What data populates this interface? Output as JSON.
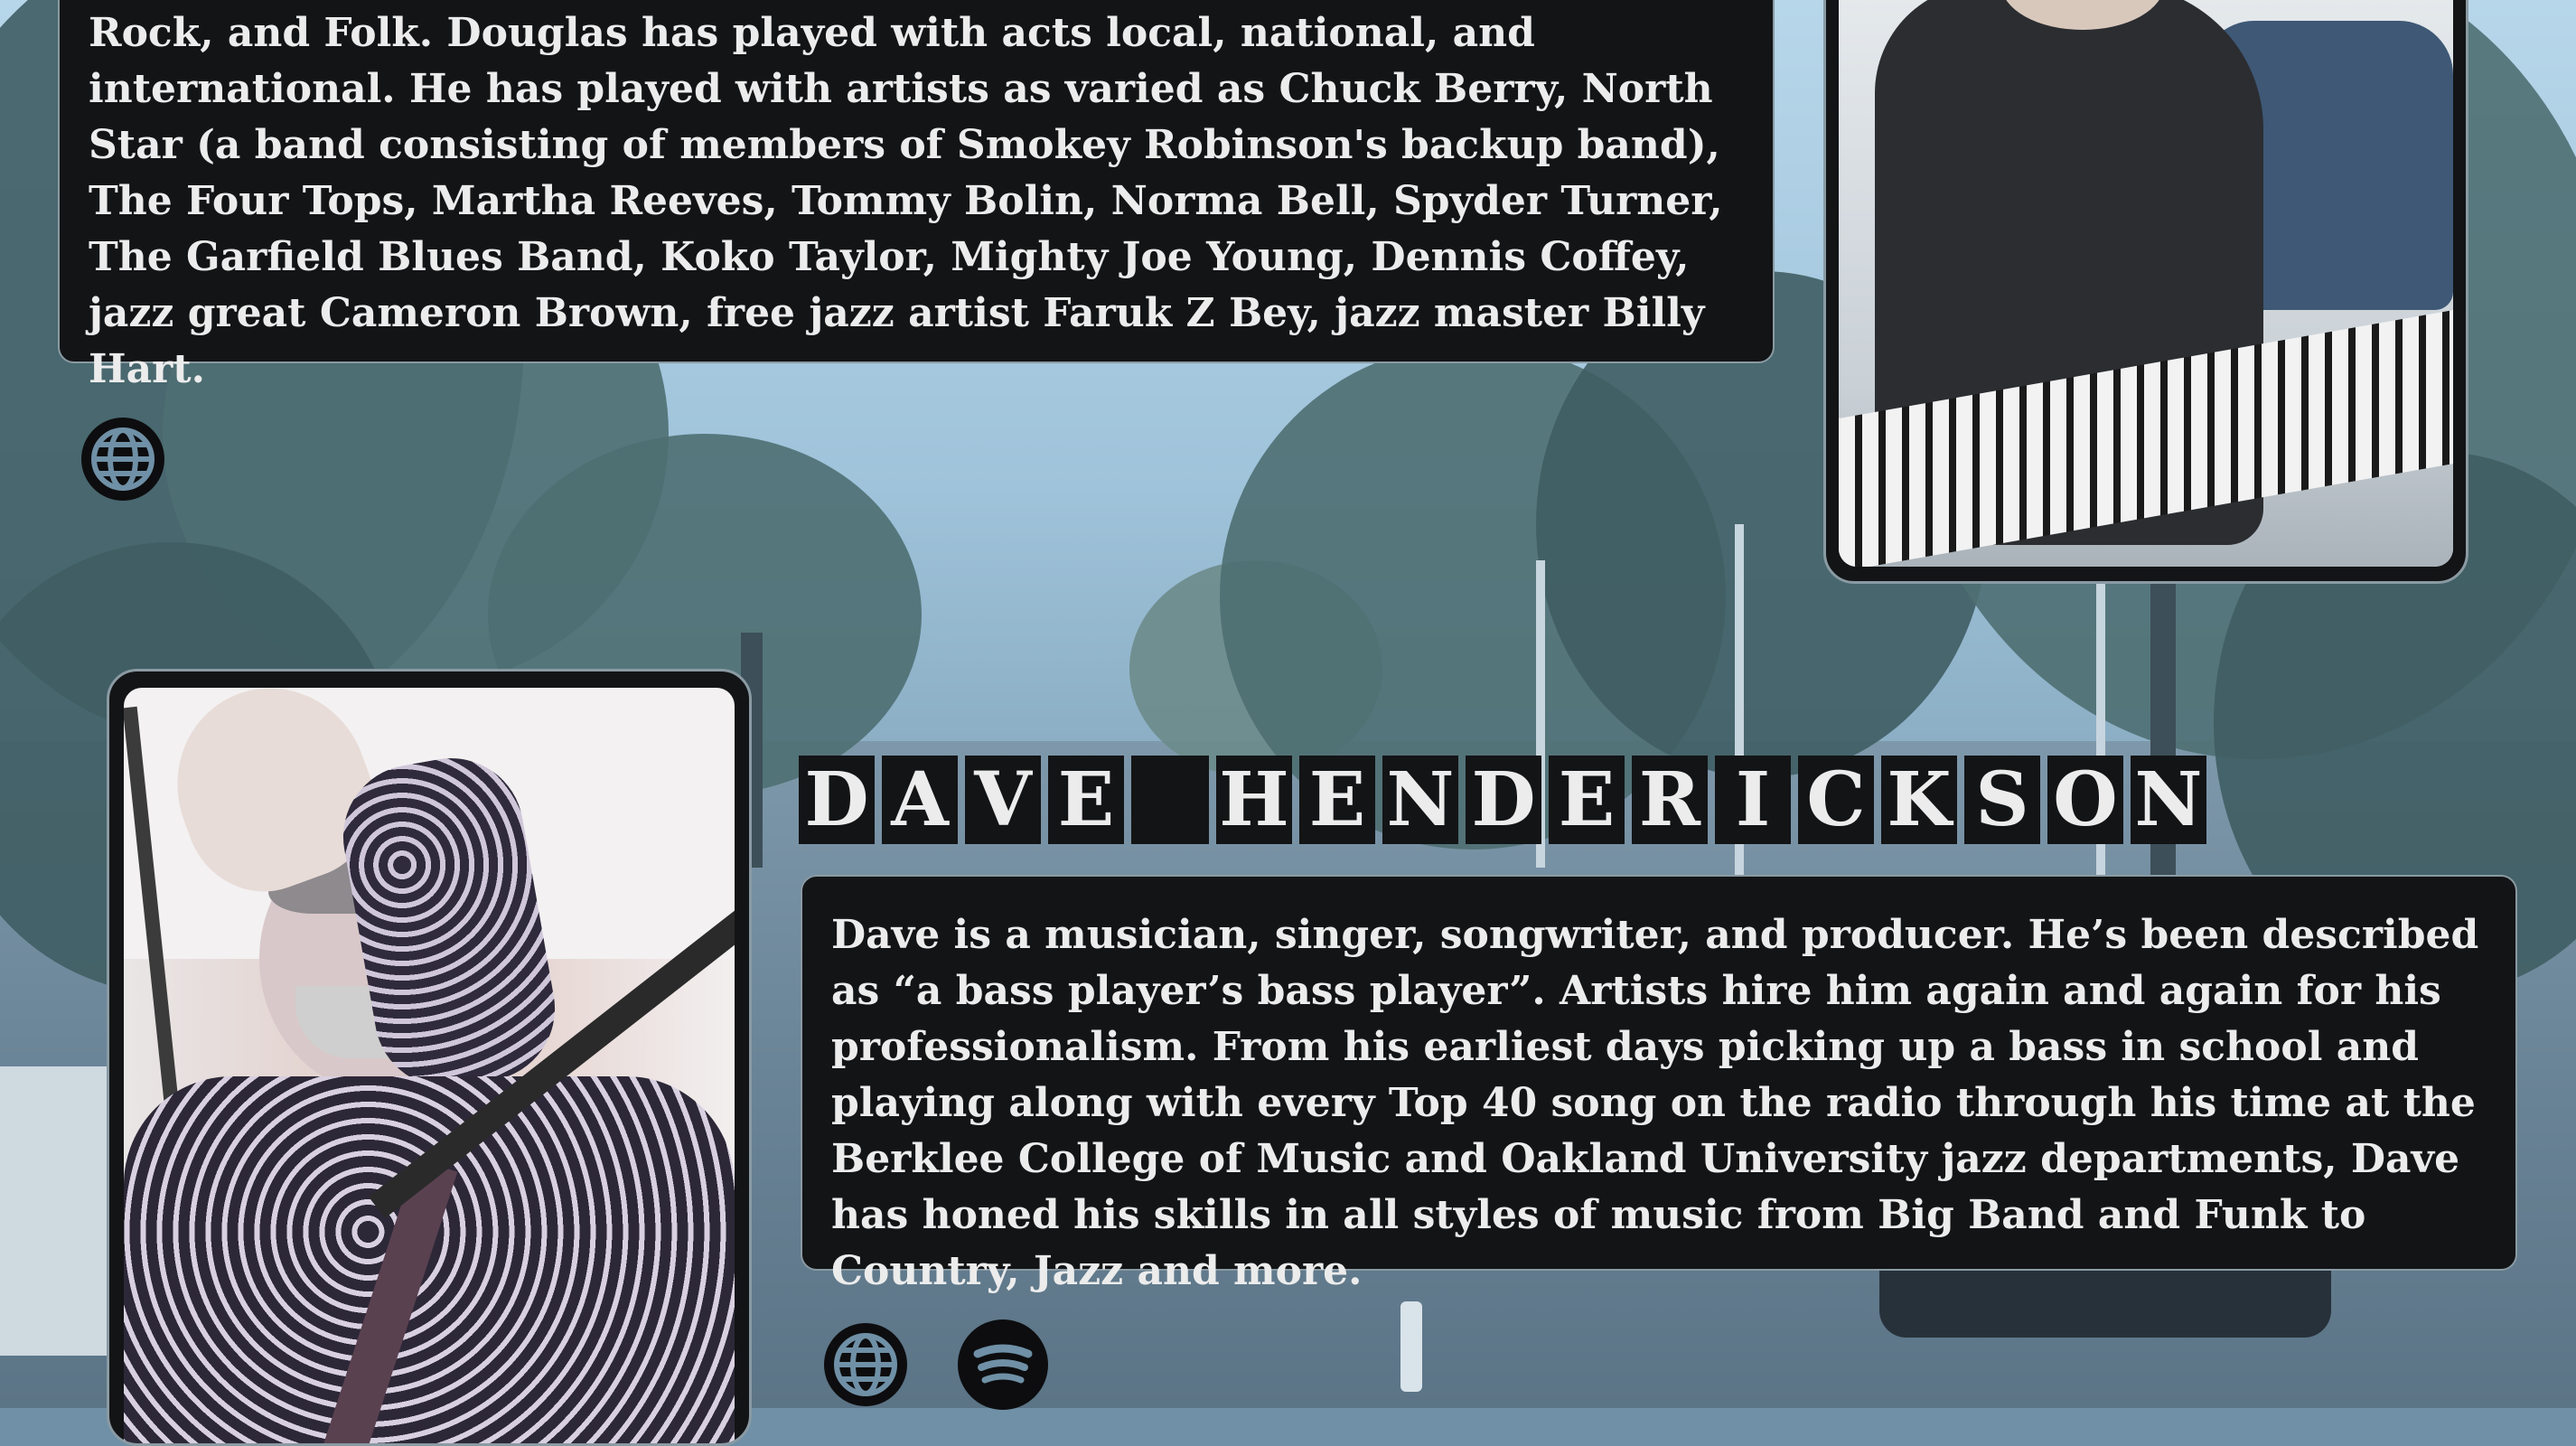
{
  "musician_1": {
    "bio": "Rock, and Folk. Douglas has played with acts local, national, and international. He has played with artists as varied as Chuck Berry, North Star (a band consisting of members of Smokey Robinson's backup band), The Four Tops, Martha Reeves, Tommy Bolin, Norma Bell, Spyder Turner, The Garfield Blues Band, Koko Taylor, Mighty Joe Young, Dennis Coffey, jazz great Cameron Brown, free jazz artist Faruk Z Bey, jazz master Billy Hart.",
    "links": [
      {
        "icon": "globe-icon"
      }
    ]
  },
  "musician_2": {
    "name": "DAVE HENDERICKSON",
    "bio": "Dave is a musician, singer, songwriter, and producer. He’s been described as “a bass player’s bass player”. Artists hire him again and again for his professionalism. From his earliest days picking up a bass in school and playing along with every Top 40 song on the radio through his time at the Berklee College of Music and Oakland University jazz departments, Dave has honed his skills in all styles of music from Big Band and Funk to Country, Jazz and more.",
    "links": [
      {
        "icon": "globe-icon"
      },
      {
        "icon": "spotify-icon"
      }
    ]
  },
  "colors": {
    "card_bg": "#131416",
    "card_border": "#8a9aa3",
    "text": "#ececec",
    "page_tint": "#6f90a6"
  }
}
